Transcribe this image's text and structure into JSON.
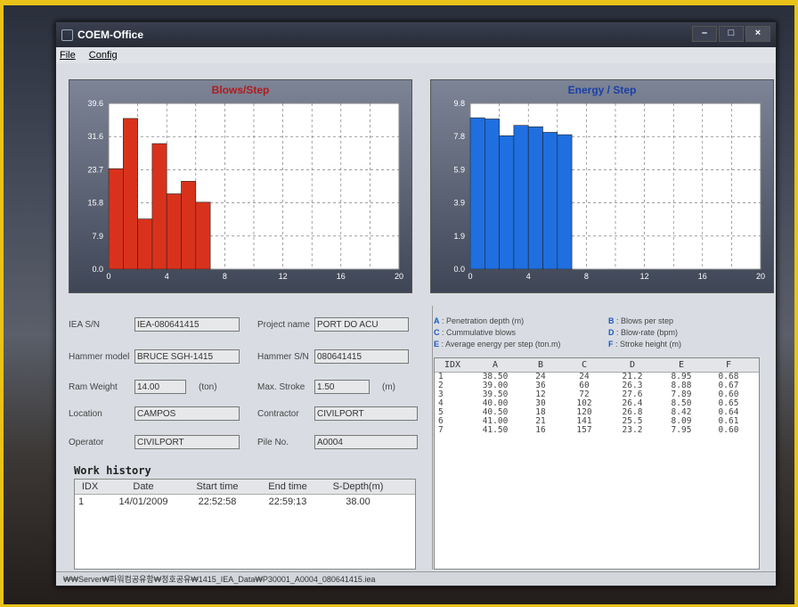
{
  "window": {
    "title": "COEM-Office",
    "controls": {
      "minimize": "–",
      "maximize": "□",
      "close": "×"
    }
  },
  "menu": {
    "file": "File",
    "config": "Config"
  },
  "colors": {
    "blows_bar": "#d9321c",
    "energy_bar": "#1f6fe0",
    "legend_key": "#1a58c8"
  },
  "chart_data": [
    {
      "type": "bar",
      "title": "Blows/Step",
      "x": [
        0,
        1,
        2,
        3,
        4,
        5,
        6
      ],
      "values": [
        24,
        36,
        12,
        30,
        18,
        21,
        16
      ],
      "xlim": [
        0,
        20
      ],
      "ylim": [
        0,
        39.6
      ],
      "xticks": [
        "0",
        "4",
        "8",
        "12",
        "16",
        "20"
      ],
      "yticks": [
        "0.0",
        "7.9",
        "15.8",
        "23.7",
        "31.6",
        "39.6"
      ],
      "grid": true
    },
    {
      "type": "bar",
      "title": "Energy / Step",
      "x": [
        0,
        1,
        2,
        3,
        4,
        5,
        6
      ],
      "values": [
        8.95,
        8.88,
        7.89,
        8.5,
        8.42,
        8.09,
        7.95
      ],
      "xlim": [
        0,
        20
      ],
      "ylim": [
        0,
        9.8
      ],
      "xticks": [
        "0",
        "4",
        "8",
        "12",
        "16",
        "20"
      ],
      "yticks": [
        "0.0",
        "1.9",
        "3.9",
        "5.9",
        "7.8",
        "9.8"
      ],
      "grid": true
    }
  ],
  "form": {
    "iea_sn_label": "IEA S/N",
    "iea_sn_value": "IEA-080641415",
    "project_name_label": "Project name",
    "project_name_value": "PORT DO ACU",
    "hammer_model_label": "Hammer model",
    "hammer_model_value": "BRUCE SGH-1415",
    "hammer_sn_label": "Hammer S/N",
    "hammer_sn_value": "080641415",
    "ram_weight_label": "Ram Weight",
    "ram_weight_value": "14.00",
    "ram_weight_unit": "(ton)",
    "max_stroke_label": "Max. Stroke",
    "max_stroke_value": "1.50",
    "max_stroke_unit": "(m)",
    "location_label": "Location",
    "location_value": "CAMPOS",
    "contractor_label": "Contractor",
    "contractor_value": "CIVILPORT",
    "operator_label": "Operator",
    "operator_value": "CIVILPORT",
    "pile_no_label": "Pile No.",
    "pile_no_value": "A0004"
  },
  "work_history": {
    "title": "Work history",
    "headers": [
      "IDX",
      "Date",
      "Start time",
      "End time",
      "S-Depth(m)"
    ],
    "rows": [
      [
        "1",
        "14/01/2009",
        "22:52:58",
        "22:59:13",
        "38.00"
      ]
    ]
  },
  "legend": [
    {
      "key": "A",
      "text": "Penetration depth (m)"
    },
    {
      "key": "B",
      "text": "Blows per step"
    },
    {
      "key": "C",
      "text": "Cummulative blows"
    },
    {
      "key": "D",
      "text": "Blow-rate (bpm)"
    },
    {
      "key": "E",
      "text": "Average energy per step (ton.m)"
    },
    {
      "key": "F",
      "text": "Stroke height (m)"
    }
  ],
  "data_table": {
    "headers": [
      "IDX",
      "A",
      "B",
      "C",
      "D",
      "E",
      "F"
    ],
    "rows": [
      [
        "1",
        "38.50",
        "24",
        "24",
        "21.2",
        "8.95",
        "0.68"
      ],
      [
        "2",
        "39.00",
        "36",
        "60",
        "26.3",
        "8.88",
        "0.67"
      ],
      [
        "3",
        "39.50",
        "12",
        "72",
        "27.6",
        "7.89",
        "0.60"
      ],
      [
        "4",
        "40.00",
        "30",
        "102",
        "26.4",
        "8.50",
        "0.65"
      ],
      [
        "5",
        "40.50",
        "18",
        "120",
        "26.8",
        "8.42",
        "0.64"
      ],
      [
        "6",
        "41.00",
        "21",
        "141",
        "25.5",
        "8.09",
        "0.61"
      ],
      [
        "7",
        "41.50",
        "16",
        "157",
        "23.2",
        "7.95",
        "0.60"
      ]
    ]
  },
  "status_path": "₩₩Server₩파워컴공유함₩정호공유₩1415_IEA_Data₩P30001_A0004_080641415.iea"
}
